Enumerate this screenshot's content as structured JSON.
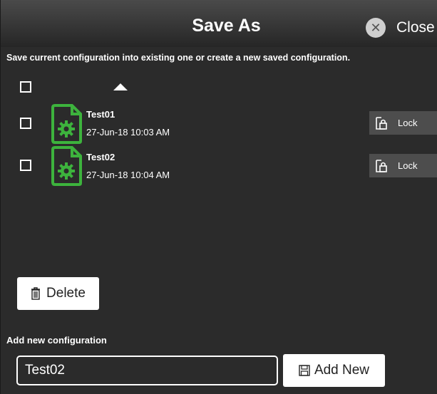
{
  "dialog": {
    "title": "Save As",
    "close_label": "Close",
    "instruction": "Save current configuration into existing one or create a new saved configuration."
  },
  "list": {
    "items": [
      {
        "name": "Test01",
        "date": "27-Jun-18 10:03 AM",
        "lock_label": "Lock"
      },
      {
        "name": "Test02",
        "date": "27-Jun-18 10:04 AM",
        "lock_label": "Lock"
      }
    ]
  },
  "actions": {
    "delete_label": "Delete"
  },
  "add_new": {
    "section_label": "Add new configuration",
    "input_value": "Test02",
    "button_label": "Add New"
  },
  "icons": {
    "close": "close-icon",
    "sort": "sort-ascending-icon",
    "file": "settings-file-icon",
    "lock": "lock-icon",
    "trash": "trash-icon",
    "save": "floppy-disk-icon"
  },
  "colors": {
    "background": "#2b2b2b",
    "accent_green": "#3db33d",
    "lock_button": "#4d4d4d"
  }
}
